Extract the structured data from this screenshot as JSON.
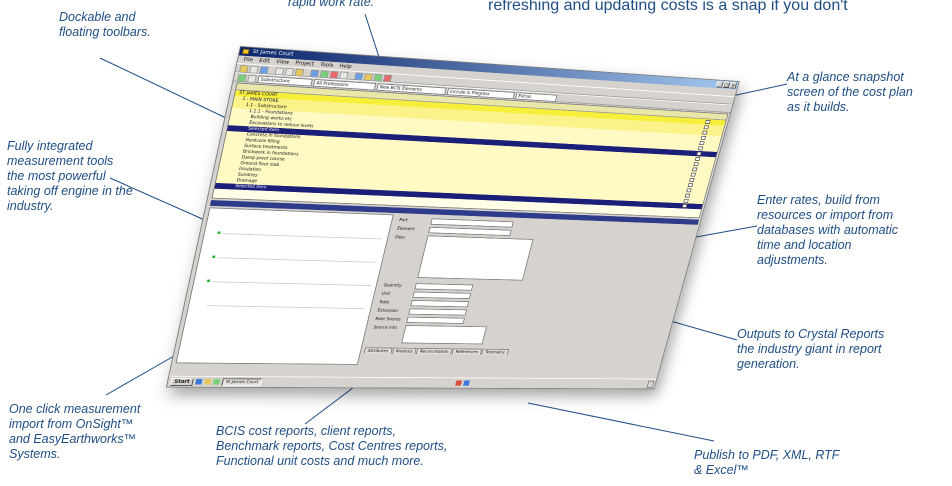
{
  "headline": "refreshing and updating costs is a snap if you don't",
  "callouts": {
    "rapid": "rapid work rate.",
    "toolbars": "Dockable and\nfloating toolbars.",
    "snapshot": "At a glance snapshot\nscreen of the cost plan\nas it builds.",
    "measurement": "Fully integrated\nmeasurement tools\nthe most powerful\ntaking off engine in the\nindustry.",
    "rates": "Enter rates, build from\nresources or import from\ndatabases with automatic\ntime and location\nadjustments.",
    "crystal": "Outputs to Crystal Reports\nthe industry giant in report\ngeneration.",
    "oneclick": "One click measurement\nimport from OnSight™\nand EasyEarthworks™\nSystems.",
    "bcis": "BCIS cost reports, client reports,\nBenchmark reports, Cost Centres reports,\nFunctional unit costs and much more.",
    "publish": "Publish to PDF, XML, RTF\n& Excel™"
  },
  "app": {
    "menu": [
      "File",
      "Edit",
      "View",
      "Project",
      "Tools",
      "Help"
    ],
    "combos": [
      "Substructure",
      "All Professions",
      "New BCIS Elements",
      "Include in Progress",
      "Extras"
    ],
    "tree_rows": [
      {
        "style": "g1",
        "desc": "ST JAMES COURT"
      },
      {
        "style": "g2",
        "desc": "1 - MAIN STORE"
      },
      {
        "style": "g2",
        "desc": "1.1 - Substructure"
      },
      {
        "style": "g3",
        "desc": "1.1.1 - Foundations"
      },
      {
        "style": "g3",
        "desc": "Building works etc"
      },
      {
        "style": "g3",
        "desc": "Excavations to reduce levels"
      },
      {
        "style": "sel",
        "desc": "Selected item"
      },
      {
        "style": "g3",
        "desc": "Concrete in foundations"
      },
      {
        "style": "g3",
        "desc": "Hardcore filling"
      },
      {
        "style": "g3",
        "desc": "Surface treatments"
      },
      {
        "style": "g3",
        "desc": "Brickwork in foundations"
      },
      {
        "style": "g3",
        "desc": "Damp proof course"
      },
      {
        "style": "g3",
        "desc": "Ground floor slab"
      },
      {
        "style": "g3",
        "desc": "Insulation"
      },
      {
        "style": "g3",
        "desc": "Sundries"
      },
      {
        "style": "g3",
        "desc": "Drainage"
      },
      {
        "style": "sel",
        "desc": "Selected item"
      }
    ],
    "form_labels": [
      "Part",
      "Element",
      "Desc",
      "Quantity",
      "Unit",
      "Rate",
      "Extension",
      "Rate Source",
      "Source Info"
    ],
    "tabs": [
      "Attributes",
      "Analysis",
      "Reconciliation",
      "References",
      "Telemetry"
    ],
    "taskbar": {
      "start": "Start",
      "task": "St James Court"
    }
  }
}
